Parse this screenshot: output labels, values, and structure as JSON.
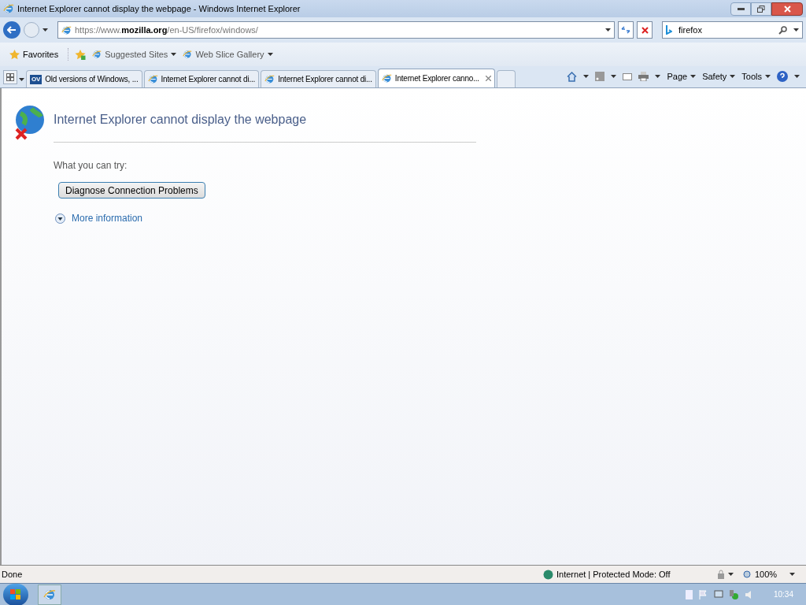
{
  "window": {
    "title": "Internet Explorer cannot display the webpage - Windows Internet Explorer"
  },
  "address_bar": {
    "url_prefix": "https://www.",
    "url_domain": "mozilla.org",
    "url_path": "/en-US/firefox/windows/"
  },
  "search": {
    "value": "firefox"
  },
  "favorites_bar": {
    "favorites": "Favorites",
    "links": [
      {
        "label": "Suggested Sites"
      },
      {
        "label": "Web Slice Gallery"
      }
    ]
  },
  "tabs": [
    {
      "kind": "site",
      "badge": "OV",
      "label": "Old versions of Windows, ...",
      "selected": false
    },
    {
      "kind": "ie",
      "label": "Internet Explorer cannot di...",
      "selected": false
    },
    {
      "kind": "ie",
      "label": "Internet Explorer cannot di...",
      "selected": false
    },
    {
      "kind": "ie",
      "label": "Internet Explorer canno...",
      "selected": true
    }
  ],
  "command_bar": [
    "Page",
    "Safety",
    "Tools"
  ],
  "error_page": {
    "heading": "Internet Explorer cannot display the webpage",
    "subheading": "What you can try:",
    "button": "Diagnose Connection Problems",
    "more": "More information"
  },
  "status_bar": {
    "status": "Done",
    "zone": "Internet | Protected Mode: Off",
    "zoom": "100%"
  },
  "taskbar": {
    "clock": "10:34"
  }
}
